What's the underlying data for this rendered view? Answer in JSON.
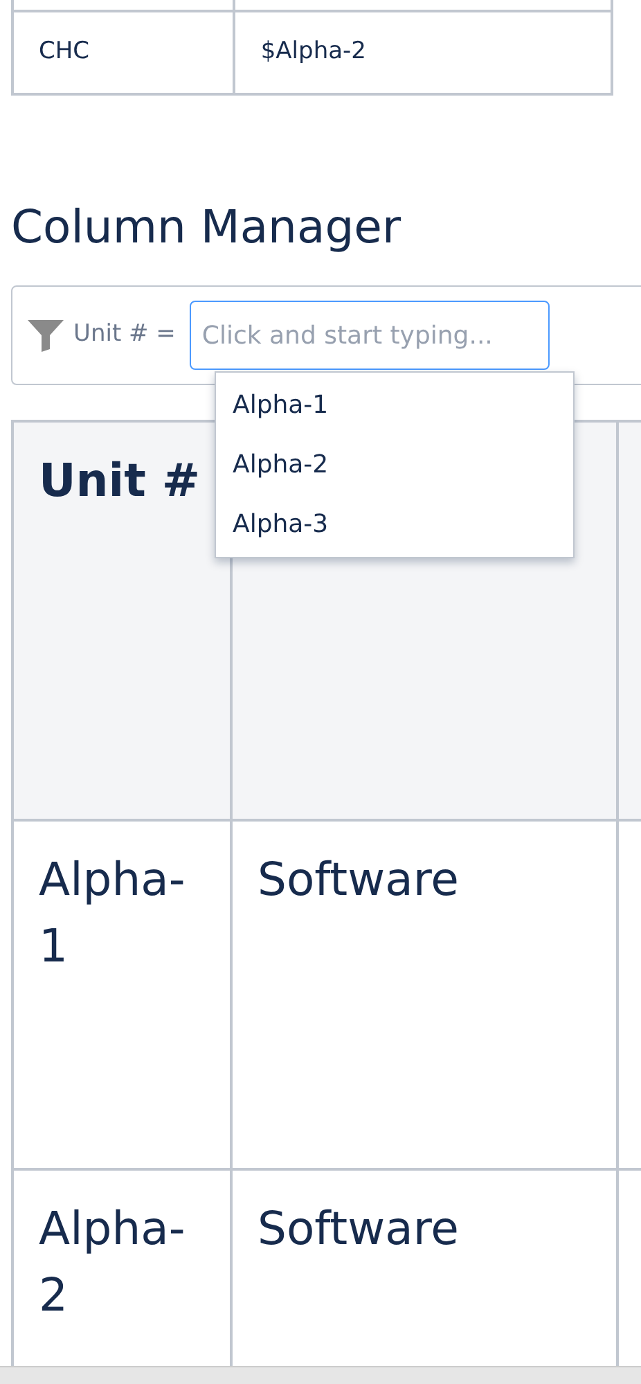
{
  "top_table": {
    "rows": [
      [
        "CHC",
        "$Alpha-2"
      ]
    ]
  },
  "heading": "Column Manager",
  "filter": {
    "label": "Unit # =",
    "placeholder": "Click and start typing...",
    "suggestions": [
      "Alpha-1",
      "Alpha-2",
      "Alpha-3"
    ]
  },
  "table": {
    "columns": [
      "Unit #"
    ],
    "rows": [
      [
        "Alpha-1",
        "Software"
      ],
      [
        "Alpha-2",
        "Software"
      ]
    ]
  }
}
